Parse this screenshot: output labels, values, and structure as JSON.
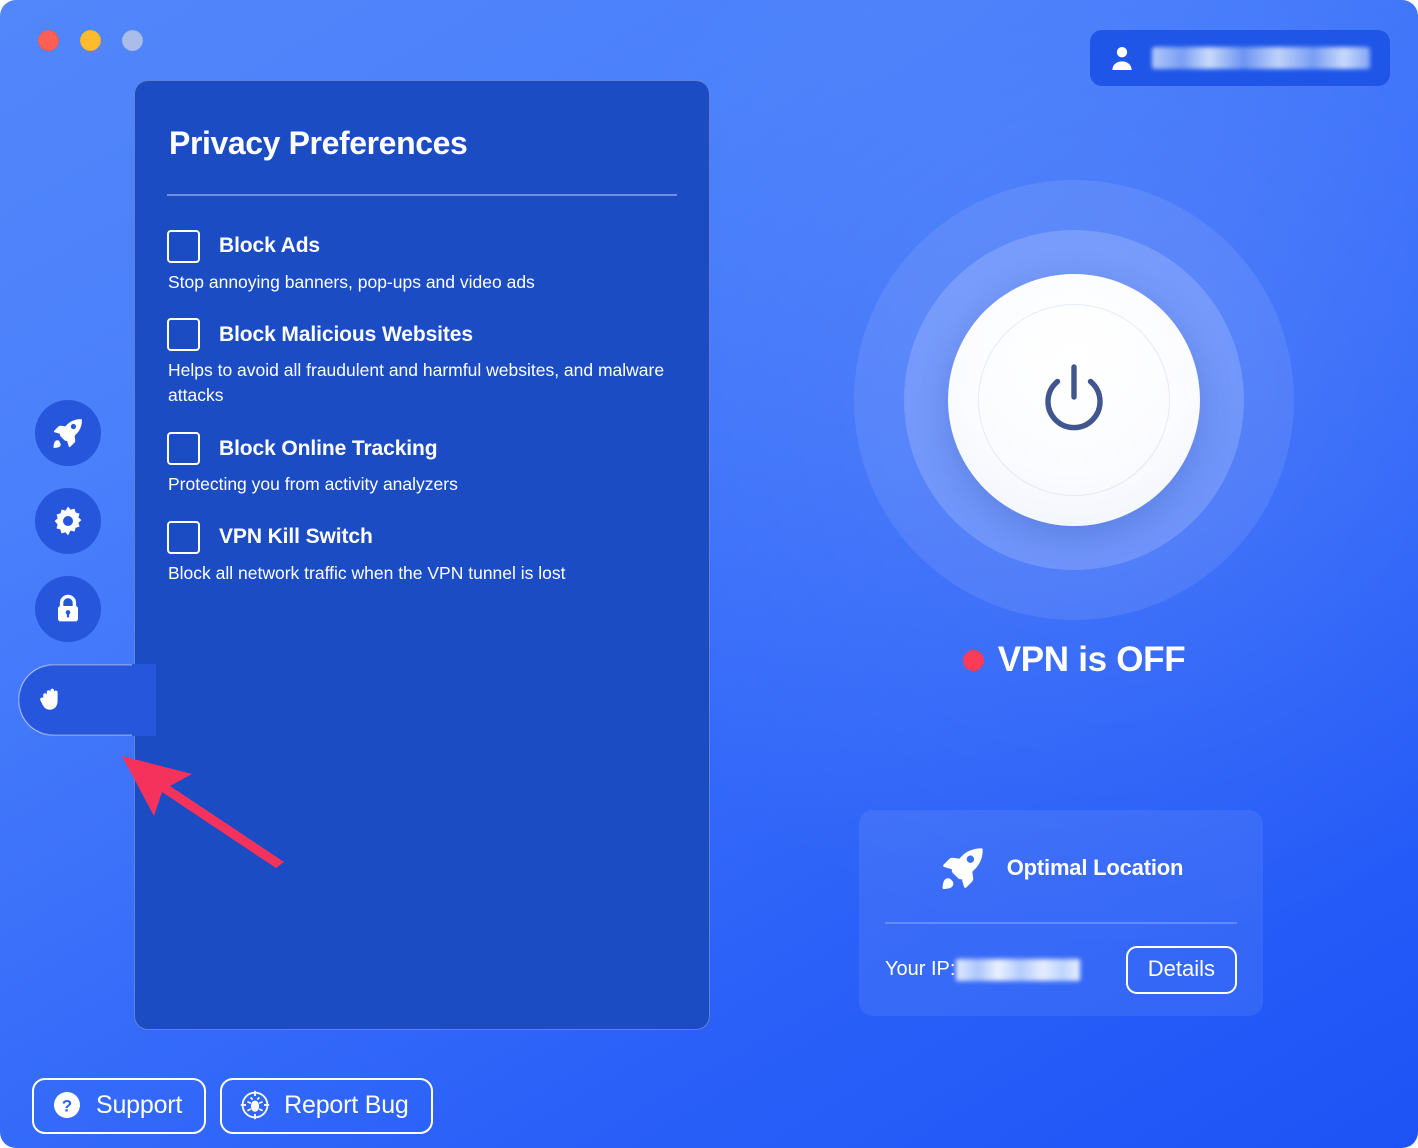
{
  "window": {
    "traffic_lights": [
      {
        "name": "close",
        "color": "#fd5f57"
      },
      {
        "name": "minimize",
        "color": "#febb2e"
      },
      {
        "name": "maximize",
        "color": "#a9bcea"
      }
    ]
  },
  "account": {
    "icon": "user-icon",
    "name_redacted": true,
    "name": ""
  },
  "sidebar": {
    "items": [
      {
        "id": "locations",
        "icon": "rocket-icon",
        "active": false
      },
      {
        "id": "settings",
        "icon": "gear-icon",
        "active": false
      },
      {
        "id": "security",
        "icon": "lock-icon",
        "active": false
      },
      {
        "id": "privacy",
        "icon": "hand-icon",
        "active": true
      }
    ]
  },
  "panel": {
    "title": "Privacy Preferences",
    "preferences": [
      {
        "label": "Block Ads",
        "description": "Stop annoying banners, pop-ups and video ads",
        "checked": false
      },
      {
        "label": "Block Malicious Websites",
        "description": "Helps to avoid all fraudulent and harmful websites, and malware attacks",
        "checked": false
      },
      {
        "label": "Block Online Tracking",
        "description": "Protecting you from activity analyzers",
        "checked": false
      },
      {
        "label": "VPN Kill Switch",
        "description": "Block all network traffic when the VPN tunnel is lost",
        "checked": false
      }
    ]
  },
  "connection": {
    "power_icon": "power-icon",
    "status_text": "VPN is OFF",
    "status_color": "#fb3b58",
    "connected": false
  },
  "location_card": {
    "icon": "rocket-icon",
    "label": "Optimal Location",
    "ip_label": "Your IP:",
    "ip_value_redacted": true,
    "ip_value": "",
    "details_label": "Details"
  },
  "footer": {
    "buttons": [
      {
        "label": "Support",
        "icon": "question-mark-icon"
      },
      {
        "label": "Report Bug",
        "icon": "bug-target-icon"
      }
    ]
  },
  "annotation": {
    "type": "arrow",
    "color": "#f5325b",
    "points_to": "sidebar-item-privacy"
  },
  "colors": {
    "background_light": "#5286fb",
    "background_dark": "#1d53f6",
    "panel": "#1c4cc4",
    "rail_button": "#2656dc",
    "accent_red": "#fb3b58",
    "white": "#ffffff"
  }
}
